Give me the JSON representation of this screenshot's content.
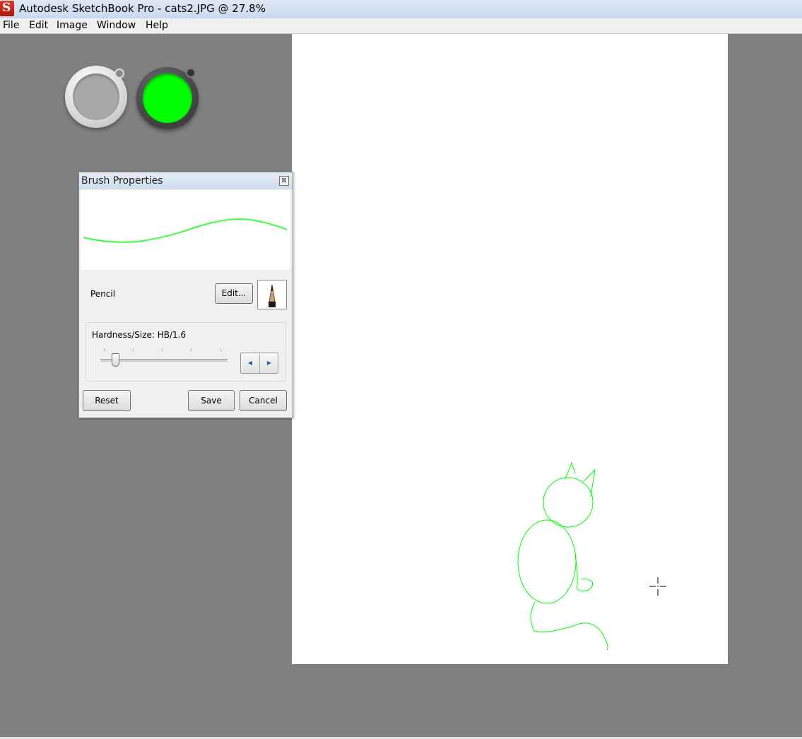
{
  "window": {
    "title": "Autodesk SketchBook Pro - cats2.JPG @ 27.8%",
    "app_icon_letter": "S"
  },
  "menu": {
    "items": [
      "File",
      "Edit",
      "Image",
      "Window",
      "Help"
    ]
  },
  "colors": {
    "secondary_color": "#a8a8a8",
    "primary_color": "#00ff00",
    "stroke_color": "#00ff00",
    "canvas_background": "#ffffff",
    "workspace_background": "#808080"
  },
  "brush_panel": {
    "title": "Brush Properties",
    "close_glyph": "⊠",
    "brush_name": "Pencil",
    "edit_label": "Edit...",
    "brush_icon": "pencil-icon",
    "hardness_size_label": "Hardness/Size: HB/1.6",
    "slider_level": 0.12,
    "stepper_left_glyph": "◀",
    "stepper_right_glyph": "▶",
    "reset_label": "Reset",
    "save_label": "Save",
    "cancel_label": "Cancel"
  },
  "cursor_icon": "crosshair-icon"
}
